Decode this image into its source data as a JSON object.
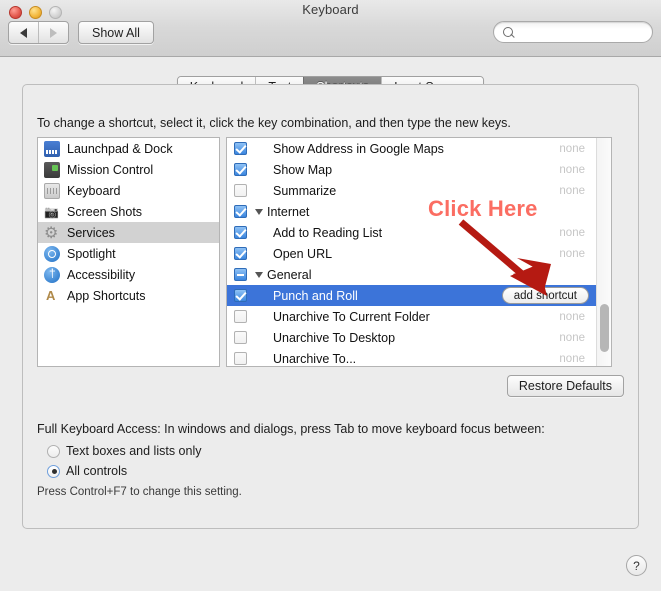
{
  "window": {
    "title": "Keyboard",
    "traffic_lights": [
      "close",
      "minimize",
      "zoom"
    ],
    "back_label": "back",
    "forward_label": "forward",
    "show_all_label": "Show All"
  },
  "search": {
    "value": "",
    "placeholder": ""
  },
  "tabs": [
    {
      "label": "Keyboard",
      "selected": false
    },
    {
      "label": "Text",
      "selected": false
    },
    {
      "label": "Shortcuts",
      "selected": true
    },
    {
      "label": "Input Sources",
      "selected": false
    }
  ],
  "instruction": "To change a shortcut, select it, click the key combination, and then type the new keys.",
  "sidebar": {
    "items": [
      {
        "label": "Launchpad & Dock",
        "icon": "launchpad-icon",
        "selected": false
      },
      {
        "label": "Mission Control",
        "icon": "mission-control-icon",
        "selected": false
      },
      {
        "label": "Keyboard",
        "icon": "keyboard-icon",
        "selected": false
      },
      {
        "label": "Screen Shots",
        "icon": "screenshots-icon",
        "selected": false
      },
      {
        "label": "Services",
        "icon": "services-gear-icon",
        "selected": true
      },
      {
        "label": "Spotlight",
        "icon": "spotlight-icon",
        "selected": false
      },
      {
        "label": "Accessibility",
        "icon": "accessibility-icon",
        "selected": false
      },
      {
        "label": "App Shortcuts",
        "icon": "app-shortcuts-icon",
        "selected": false
      }
    ]
  },
  "shortcut_list": {
    "rows": [
      {
        "label": "Show Address in Google Maps",
        "checkbox": "on",
        "type": "item",
        "shortcut": "none",
        "selected": false
      },
      {
        "label": "Show Map",
        "checkbox": "on",
        "type": "item",
        "shortcut": "none",
        "selected": false
      },
      {
        "label": "Summarize",
        "checkbox": "off",
        "type": "item",
        "shortcut": "none",
        "selected": false
      },
      {
        "label": "Internet",
        "checkbox": "on",
        "type": "group",
        "shortcut": "",
        "selected": false
      },
      {
        "label": "Add to Reading List",
        "checkbox": "on",
        "type": "item",
        "shortcut": "none",
        "selected": false
      },
      {
        "label": "Open URL",
        "checkbox": "on",
        "type": "item",
        "shortcut": "none",
        "selected": false
      },
      {
        "label": "General",
        "checkbox": "mixed",
        "type": "group",
        "shortcut": "",
        "selected": false
      },
      {
        "label": "Punch and Roll",
        "checkbox": "on",
        "type": "item",
        "shortcut": "add shortcut",
        "selected": true
      },
      {
        "label": "Unarchive To Current Folder",
        "checkbox": "off",
        "type": "item",
        "shortcut": "none",
        "selected": false
      },
      {
        "label": "Unarchive To Desktop",
        "checkbox": "off",
        "type": "item",
        "shortcut": "none",
        "selected": false
      },
      {
        "label": "Unarchive To...",
        "checkbox": "off",
        "type": "item",
        "shortcut": "none",
        "selected": false
      }
    ]
  },
  "restore_defaults_label": "Restore Defaults",
  "full_keyboard_access": {
    "description": "Full Keyboard Access: In windows and dialogs, press Tab to move keyboard focus between:",
    "options": [
      {
        "label": "Text boxes and lists only",
        "selected": false
      },
      {
        "label": "All controls",
        "selected": true
      }
    ],
    "hint": "Press Control+F7 to change this setting."
  },
  "annotation": {
    "text": "Click Here",
    "text_color": "#fb6d62",
    "arrow_color": "#b51a12"
  },
  "help_label": "?"
}
